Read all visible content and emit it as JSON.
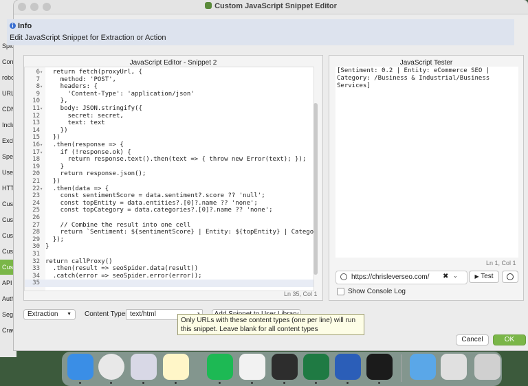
{
  "background_app": {
    "items": [
      "Spid",
      "Cont",
      "robo",
      "URL",
      "CDN",
      "Inclu",
      "Exclu",
      "Spec",
      "User",
      "HTT",
      "Cust",
      "Custo",
      "Cus",
      "Custo",
      "Custo",
      "API A",
      "Auth",
      "Segr",
      "Crav"
    ],
    "selected_index": 14
  },
  "window": {
    "title": "Custom JavaScript Snippet Editor"
  },
  "info": {
    "title": "Info",
    "text": "Edit JavaScript Snippet for Extraction or Action",
    "icon": "info-icon"
  },
  "editor": {
    "title": "JavaScript Editor - Snippet 2",
    "status": "Ln 35, Col 1",
    "lines": [
      {
        "n": "6",
        "fold": true,
        "text": "  return fetch(proxyUrl, {"
      },
      {
        "n": "7",
        "fold": false,
        "text": "    method: 'POST',"
      },
      {
        "n": "8",
        "fold": true,
        "text": "    headers: {"
      },
      {
        "n": "9",
        "fold": false,
        "text": "      'Content-Type': 'application/json'"
      },
      {
        "n": "10",
        "fold": false,
        "text": "    },"
      },
      {
        "n": "11",
        "fold": true,
        "text": "    body: JSON.stringify({"
      },
      {
        "n": "12",
        "fold": false,
        "text": "      secret: secret,"
      },
      {
        "n": "13",
        "fold": false,
        "text": "      text: text"
      },
      {
        "n": "14",
        "fold": false,
        "text": "    })"
      },
      {
        "n": "15",
        "fold": false,
        "text": "  })"
      },
      {
        "n": "16",
        "fold": true,
        "text": "  .then(response => {"
      },
      {
        "n": "17",
        "fold": true,
        "text": "    if (!response.ok) {"
      },
      {
        "n": "18",
        "fold": false,
        "text": "      return response.text().then(text => { throw new Error(text); });"
      },
      {
        "n": "19",
        "fold": false,
        "text": "    }"
      },
      {
        "n": "20",
        "fold": false,
        "text": "    return response.json();"
      },
      {
        "n": "21",
        "fold": false,
        "text": "  })"
      },
      {
        "n": "22",
        "fold": true,
        "text": "  .then(data => {"
      },
      {
        "n": "23",
        "fold": false,
        "text": "    const sentimentScore = data.sentiment?.score ?? 'null';"
      },
      {
        "n": "24",
        "fold": false,
        "text": "    const topEntity = data.entities?.[0]?.name ?? 'none';"
      },
      {
        "n": "25",
        "fold": false,
        "text": "    const topCategory = data.categories?.[0]?.name ?? 'none';"
      },
      {
        "n": "26",
        "fold": false,
        "text": ""
      },
      {
        "n": "27",
        "fold": false,
        "text": "    // Combine the result into one cell"
      },
      {
        "n": "28",
        "fold": false,
        "text": "    return `Sentiment: ${sentimentScore} | Entity: ${topEntity} | Category: ${to"
      },
      {
        "n": "29",
        "fold": false,
        "text": "  });"
      },
      {
        "n": "30",
        "fold": false,
        "text": "}"
      },
      {
        "n": "31",
        "fold": false,
        "text": ""
      },
      {
        "n": "32",
        "fold": false,
        "text": "return callProxy()"
      },
      {
        "n": "33",
        "fold": false,
        "text": "  .then(result => seoSpider.data(result))"
      },
      {
        "n": "34",
        "fold": false,
        "text": "  .catch(error => seoSpider.error(error));"
      },
      {
        "n": "35",
        "fold": false,
        "text": ""
      }
    ]
  },
  "tester": {
    "title": "JavaScript Tester",
    "output": "[Sentiment: 0.2 | Entity: eCommerce SEO | Category: /Business & Industrial/Business Services]",
    "status": "Ln 1, Col 1",
    "url": "https://chrisleverseo.com/",
    "clear": "✖",
    "dropdown": "⌄",
    "test_label": "Test",
    "show_console_label": "Show Console Log"
  },
  "bottom": {
    "mode": "Extraction",
    "content_types_label": "Content Types",
    "content_types_value": "text/html",
    "add_snippet": "Add Snippet to User Library",
    "tooltip": "Only URLs with these content types (one per line) will run this snippet. Leave blank for all content types",
    "cancel": "Cancel",
    "ok": "OK"
  },
  "dock": {
    "icons": [
      "finder-icon",
      "chrome-icon",
      "launchpad-icon",
      "notes-icon",
      "spotify-icon",
      "chatgpt-icon",
      "screaming-frog-icon",
      "excel-icon",
      "word-icon",
      "terminal-icon",
      "folder-icon",
      "screenshot-icon",
      "trash-icon"
    ]
  },
  "colors": {
    "accent_green": "#7ab648",
    "info_bg": "#dde3ee",
    "keyword": "#7a1f7a",
    "string": "#1a1aa6"
  }
}
